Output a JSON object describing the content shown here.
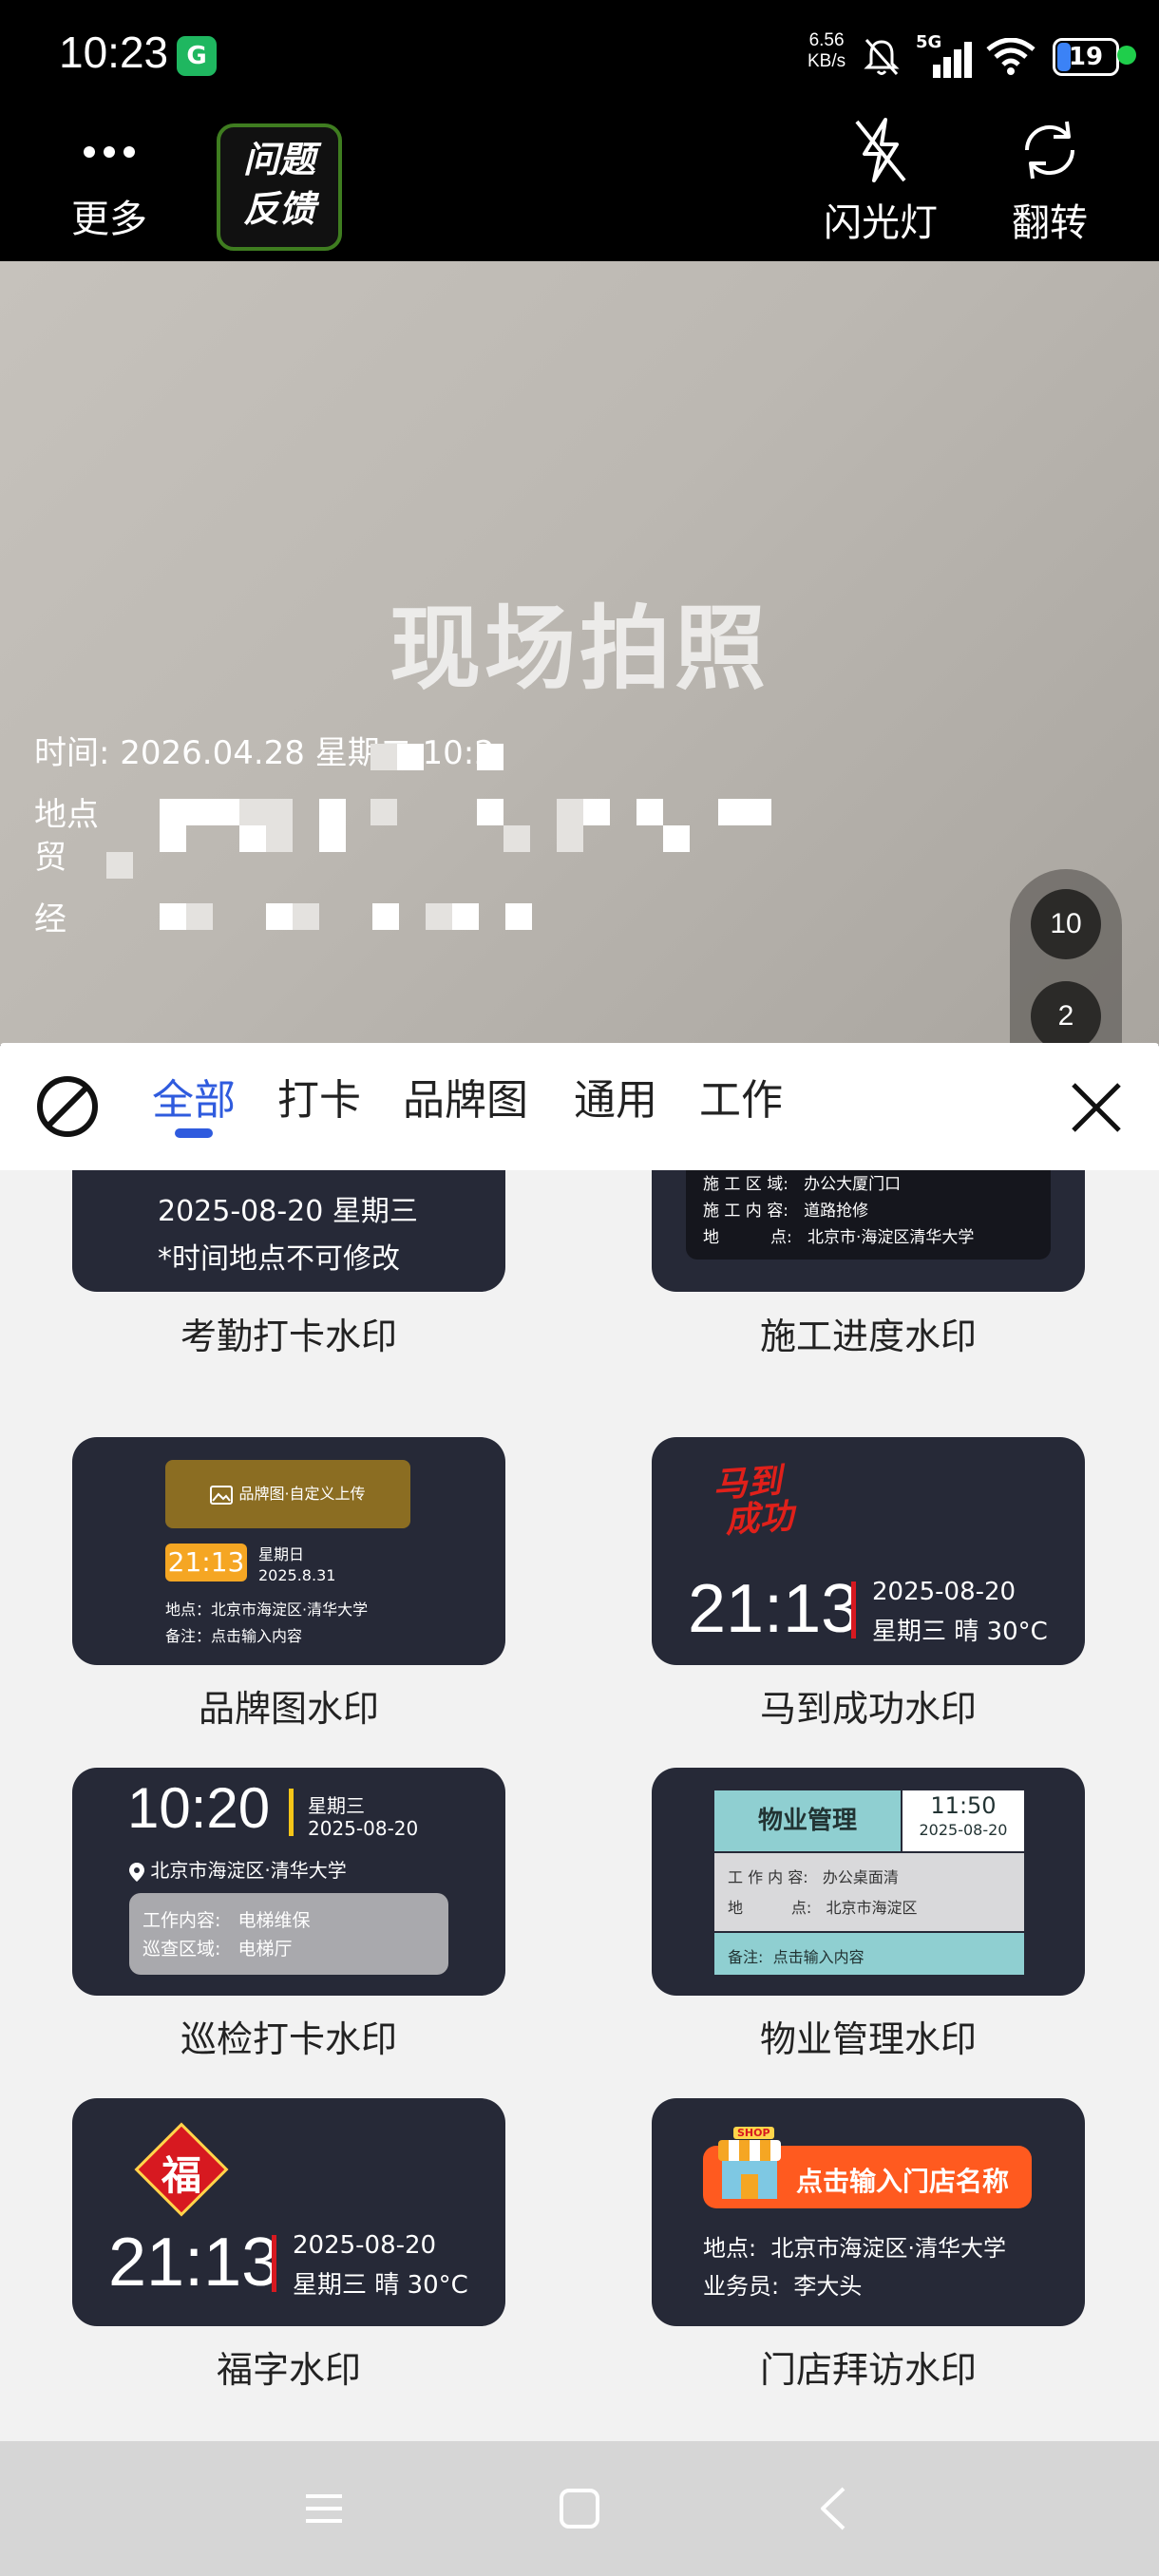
{
  "status_bar": {
    "time": "10:23",
    "app_icon": "G",
    "net_speed_value": "6.56",
    "net_speed_unit": "KB/s",
    "network": "5G",
    "battery": "19"
  },
  "toolbar": {
    "more_label": "更多",
    "feedback_line1": "问题",
    "feedback_line2": "反馈",
    "flash_label": "闪光灯",
    "flip_label": "翻转"
  },
  "preview": {
    "title": "现场拍照",
    "time_line": "时间: 2026.04.28 星期二 10:2",
    "location_prefix": "地点",
    "trade_prefix": "贸",
    "manager_prefix": "经",
    "counter_top": "10",
    "counter_bottom": "2"
  },
  "tabs": {
    "items": [
      "全部",
      "打卡",
      "品牌图",
      "通用",
      "工作"
    ],
    "active_index": 0
  },
  "templates": {
    "attendance": {
      "label": "考勤打卡水印",
      "date": "2025-08-20 星期三",
      "note": "*时间地点不可修改"
    },
    "construction": {
      "label": "施工进度水印",
      "row1": "施 工 区 域:   办公大厦门口",
      "row2": "施 工 内 容:   道路抢修",
      "row3": "地          点:   北京市·海淀区清华大学"
    },
    "brand": {
      "label": "品牌图水印",
      "banner": "品牌图·自定义上传",
      "time": "21:13",
      "weekday": "星期日",
      "date": "2025.8.31",
      "location": "地点：北京市海淀区·清华大学",
      "remark": "备注：点击输入内容"
    },
    "success": {
      "label": "马到成功水印",
      "logo_line1": "马到",
      "logo_line2": "成功",
      "time": "21:13",
      "date": "2025-08-20",
      "weather": "星期三 晴 30°C"
    },
    "patrol": {
      "label": "巡检打卡水印",
      "time": "10:20",
      "weekday": "星期三",
      "date": "2025-08-20",
      "location": "北京市海淀区·清华大学",
      "content": "工作内容:   电梯维保",
      "area": "巡查区域:   电梯厅"
    },
    "property": {
      "label": "物业管理水印",
      "title": "物业管理",
      "time": "11:50",
      "date": "2025-08-20",
      "content": "工 作 内 容:   办公桌面清",
      "place": "地          点:   北京市海淀区",
      "remark": "备注:  点击输入内容"
    },
    "fu": {
      "label": "福字水印",
      "glyph": "福",
      "time": "21:13",
      "date": "2025-08-20",
      "weather": "星期三 晴 30°C"
    },
    "store": {
      "label": "门店拜访水印",
      "shop_badge": "SHOP",
      "banner": "点击输入门店名称",
      "location": "地点:  北京市海淀区·清华大学",
      "salesman": "业务员:  李大头"
    }
  },
  "colors": {
    "accent": "#2f5bde",
    "card_bg": "#262937",
    "feedback_border": "#3f7d20",
    "gold": "#f5a623",
    "red": "#d71920"
  }
}
